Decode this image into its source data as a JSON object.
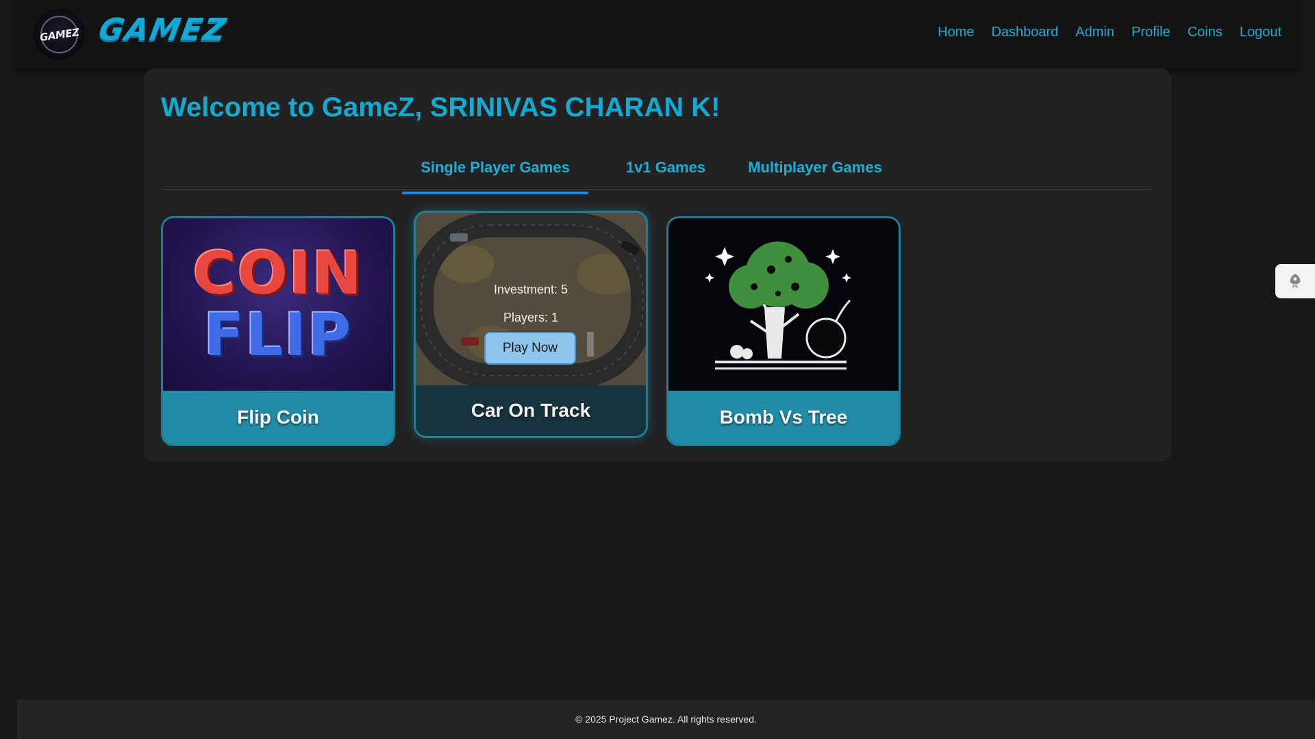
{
  "brand": {
    "logo_text": "GAMEZ",
    "name": "GAMEZ"
  },
  "nav": {
    "items": [
      {
        "label": "Home"
      },
      {
        "label": "Dashboard"
      },
      {
        "label": "Admin"
      },
      {
        "label": "Profile"
      },
      {
        "label": "Coins"
      },
      {
        "label": "Logout"
      }
    ]
  },
  "main": {
    "welcome": "Welcome to GameZ, SRINIVAS CHARAN K!",
    "tabs": [
      {
        "label": "Single Player Games",
        "active": true
      },
      {
        "label": "1v1 Games",
        "active": false
      },
      {
        "label": "Multiplayer Games",
        "active": false
      }
    ],
    "cards": [
      {
        "title": "Flip Coin",
        "thumb_text_top": "COIN",
        "thumb_text_bottom": "FLIP"
      },
      {
        "title": "Car On Track",
        "investment": "Investment: 5",
        "players": "Players: 1",
        "play_label": "Play Now"
      },
      {
        "title": "Bomb Vs Tree"
      }
    ]
  },
  "side_widget": {
    "icon": "rocket-icon"
  },
  "footer": {
    "text": "© 2025 Project Gamez. All rights reserved."
  },
  "colors": {
    "accent": "#13aad2",
    "tab_indicator": "#1e88e5",
    "card_label": "#218ca8",
    "background": "#181818"
  }
}
